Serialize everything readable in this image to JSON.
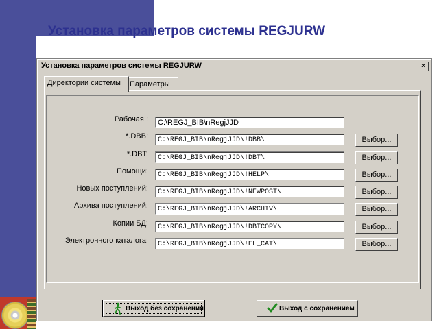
{
  "slide": {
    "title": "Установка параметров системы REGJURW"
  },
  "dialog": {
    "title": "Установка параметров системы REGJURW",
    "close_label": "×",
    "tabs": [
      {
        "label": "Директории системы",
        "active": true
      },
      {
        "label": "Параметры",
        "active": false
      }
    ],
    "rows": [
      {
        "label": "Рабочая :",
        "value": "C:\\REGJ_BIB\\nRegjJJD",
        "has_button": false
      },
      {
        "label": "*.DBB:",
        "value": "C:\\REGJ_BIB\\nRegjJJD\\!DBB\\",
        "has_button": true
      },
      {
        "label": "*.DBT:",
        "value": "C:\\REGJ_BIB\\nRegjJJD\\!DBT\\",
        "has_button": true
      },
      {
        "label": "Помощи:",
        "value": "C:\\REGJ_BIB\\nRegjJJD\\!HELP\\",
        "has_button": true
      },
      {
        "label": "Новых поступлений:",
        "value": "C:\\REGJ_BIB\\nRegjJJD\\!NEWPOST\\",
        "has_button": true
      },
      {
        "label": "Архива поступлений:",
        "value": "C:\\REGJ_BIB\\nRegjJJD\\!ARCHIV\\",
        "has_button": true
      },
      {
        "label": "Копии БД:",
        "value": "C:\\REGJ_BIB\\nRegjJJD\\!DBTCOPY\\",
        "has_button": true
      },
      {
        "label": "Электронного каталога:",
        "value": "C:\\REGJ_BIB\\nRegjJJD\\!EL_CAT\\",
        "has_button": true
      }
    ],
    "select_label": "Выбор...",
    "exit_no_save": {
      "label": "Выход без сохранения",
      "icon": "running-man-icon"
    },
    "exit_save": {
      "label": "Выход с сохранением",
      "icon": "check-mark-icon"
    }
  },
  "colors": {
    "slide_bar": "#4a4f9a",
    "title_text": "#2d3190",
    "dialog_face": "#d4d0c8",
    "check_green": "#1f8a1f"
  }
}
